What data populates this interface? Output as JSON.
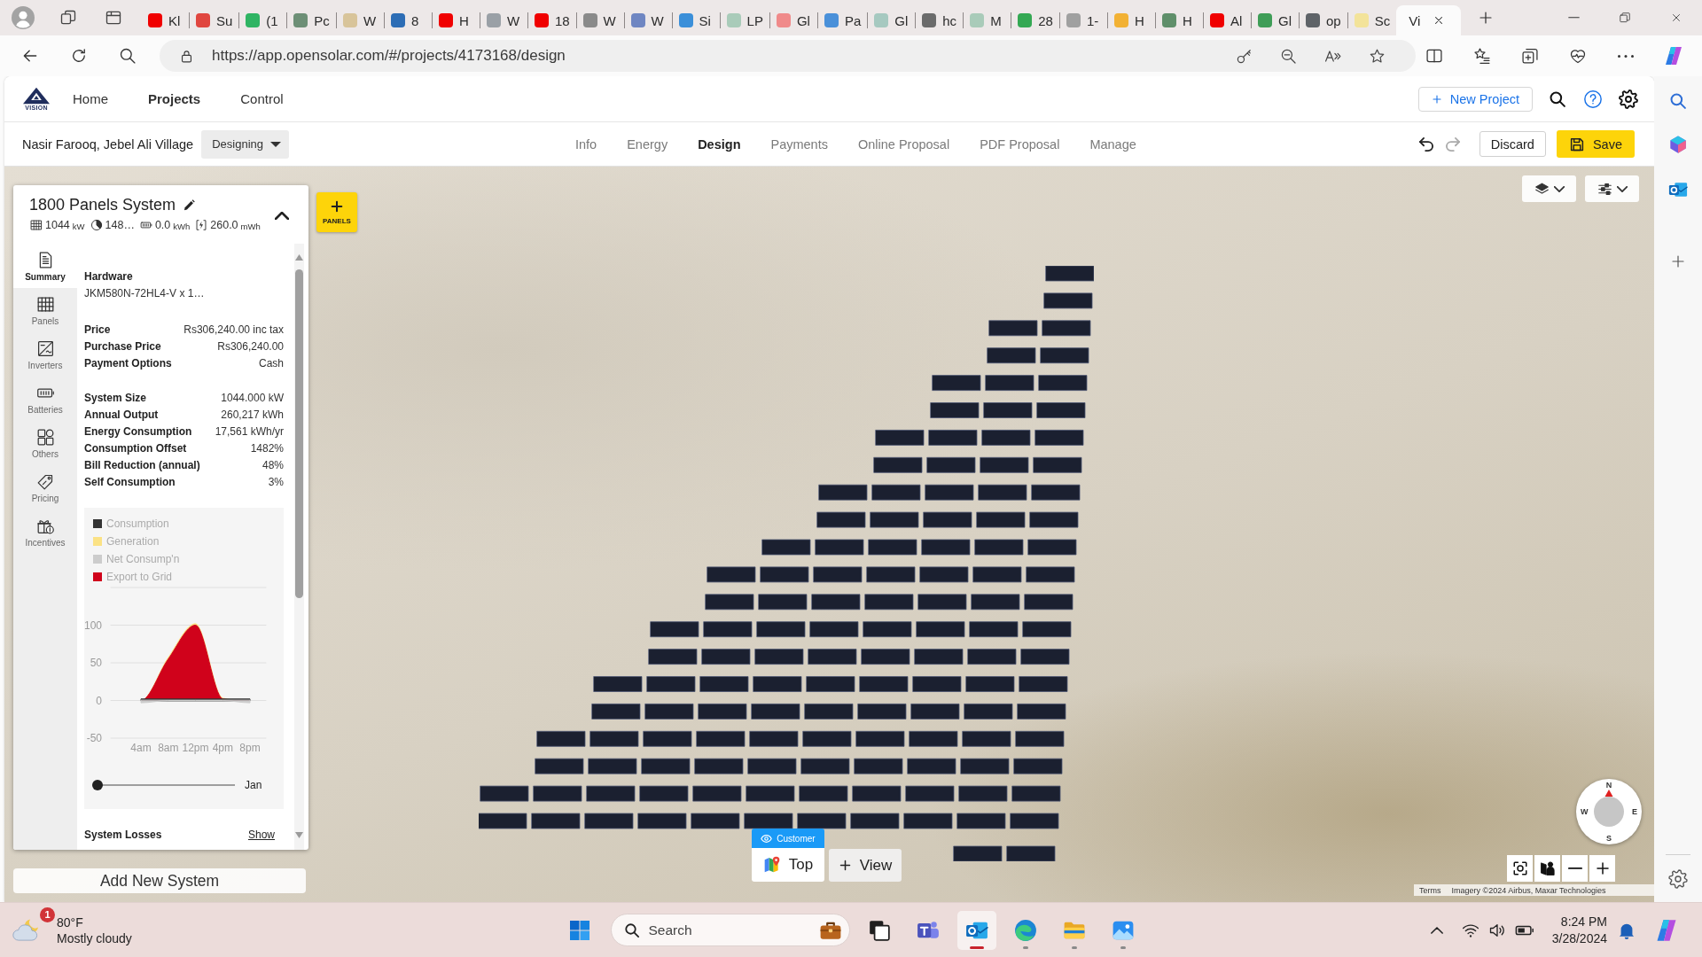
{
  "browser": {
    "tabs": [
      {
        "title": "Kl",
        "color": "#f00000",
        "selected": false
      },
      {
        "title": "Su",
        "color": "#e0463f",
        "selected": false
      },
      {
        "title": "(1",
        "color": "#2fb463",
        "selected": false
      },
      {
        "title": "Pc",
        "color": "#6d8f76",
        "selected": false
      },
      {
        "title": "W",
        "color": "#d8c49a",
        "selected": false
      },
      {
        "title": "8",
        "color": "#2d6db5",
        "selected": false
      },
      {
        "title": "H",
        "color": "#f00000",
        "selected": false
      },
      {
        "title": "W",
        "color": "#9aa0a6",
        "selected": false
      },
      {
        "title": "18",
        "color": "#f00000",
        "selected": false
      },
      {
        "title": "W",
        "color": "#8a8a8a",
        "selected": false
      },
      {
        "title": "W",
        "color": "#6f86c2",
        "selected": false
      },
      {
        "title": "Si",
        "color": "#3b8fd9",
        "selected": false
      },
      {
        "title": "LP",
        "color": "#a9cbb9",
        "selected": false
      },
      {
        "title": "Gl",
        "color": "#f08a8a",
        "selected": false
      },
      {
        "title": "Pa",
        "color": "#4a90d9",
        "selected": false
      },
      {
        "title": "Gl",
        "color": "#a6c9c0",
        "selected": false
      },
      {
        "title": "hc",
        "color": "#6b6b6b",
        "selected": false
      },
      {
        "title": "M",
        "color": "#a9cbb9",
        "selected": false
      },
      {
        "title": "28",
        "color": "#34a853",
        "selected": false
      },
      {
        "title": "1-",
        "color": "#a0a0a0",
        "selected": false
      },
      {
        "title": "H",
        "color": "#f2b134",
        "selected": false
      },
      {
        "title": "H",
        "color": "#5f8f6a",
        "selected": false
      },
      {
        "title": "Al",
        "color": "#f00000",
        "selected": false
      },
      {
        "title": "Gl",
        "color": "#3f9d57",
        "selected": false
      },
      {
        "title": "op",
        "color": "#5f6368",
        "selected": false
      },
      {
        "title": "Sc",
        "color": "#f3e39a",
        "selected": false
      },
      {
        "title": "Vi",
        "selected": true
      }
    ],
    "url": "https://app.opensolar.com/#/projects/4173168/design"
  },
  "app": {
    "logo_text": "VISION",
    "nav": [
      {
        "label": "Home",
        "selected": false
      },
      {
        "label": "Projects",
        "selected": true
      },
      {
        "label": "Control",
        "selected": false
      }
    ],
    "new_project_button": "New Project",
    "project_name": "Nasir Farooq, Jebel Ali Village",
    "stage": "Designing",
    "tabs": [
      {
        "label": "Info",
        "selected": false
      },
      {
        "label": "Energy",
        "selected": false
      },
      {
        "label": "Design",
        "selected": true
      },
      {
        "label": "Payments",
        "selected": false
      },
      {
        "label": "Online Proposal",
        "selected": false
      },
      {
        "label": "PDF Proposal",
        "selected": false
      },
      {
        "label": "Manage",
        "selected": false
      }
    ],
    "discard_button": "Discard",
    "save_button": "Save"
  },
  "system": {
    "title": "1800 Panels System",
    "stats": [
      {
        "kind": "size",
        "value": "1044",
        "unit": "kW"
      },
      {
        "kind": "output",
        "value": "148…"
      },
      {
        "kind": "battery",
        "value": "0.0",
        "unit": "kWh"
      },
      {
        "kind": "energy",
        "value": "260.0",
        "unit": "mWh"
      }
    ],
    "side_nav": [
      {
        "kind": "summary",
        "label": "Summary",
        "selected": true
      },
      {
        "kind": "panels",
        "label": "Panels",
        "selected": false
      },
      {
        "kind": "inverters",
        "label": "Inverters",
        "selected": false
      },
      {
        "kind": "batteries",
        "label": "Batteries",
        "selected": false
      },
      {
        "kind": "others",
        "label": "Others",
        "selected": false
      },
      {
        "kind": "pricing",
        "label": "Pricing",
        "selected": false
      },
      {
        "kind": "incentives",
        "label": "Incentives",
        "selected": false
      }
    ],
    "hardware": {
      "label": "Hardware",
      "value": "JKM580N-72HL4-V x 1…"
    },
    "pricing": [
      {
        "label": "Price",
        "value": "Rs306,240.00 inc tax"
      },
      {
        "label": "Purchase Price",
        "value": "Rs306,240.00"
      },
      {
        "label": "Payment Options",
        "value": "Cash"
      }
    ],
    "metrics": [
      {
        "label": "System Size",
        "value": "1044.000 kW"
      },
      {
        "label": "Annual Output",
        "value": "260,217 kWh"
      },
      {
        "label": "Energy Consumption",
        "value": "17,561 kWh/yr"
      },
      {
        "label": "Consumption Offset",
        "value": "1482%"
      },
      {
        "label": "Bill Reduction (annual)",
        "value": "48%"
      },
      {
        "label": "Self Consumption",
        "value": "3%"
      }
    ],
    "chart": {
      "chart_data": {
        "type": "area",
        "legend": "top",
        "grid": true,
        "categories": [
          "4am",
          "8am",
          "12pm",
          "4pm",
          "8pm"
        ],
        "ylim": [
          -50,
          150
        ],
        "yticks": [
          -50,
          0,
          50,
          100
        ],
        "series": [
          {
            "name": "Consumption",
            "color": "#333333",
            "values": [
              2,
              2,
              2,
              2,
              2
            ]
          },
          {
            "name": "Generation",
            "color": "#fbe285",
            "values": [
              0,
              57,
              102,
              3,
              0
            ]
          },
          {
            "name": "Net Consump'n",
            "color": "#cccccc",
            "values": [
              -3,
              0,
              0,
              0,
              -3
            ]
          },
          {
            "name": "Export to Grid",
            "color": "#d0021b",
            "values": [
              0,
              55,
              100,
              2,
              0
            ]
          }
        ]
      }
    },
    "month_slider": {
      "level": 0,
      "label": "Jan"
    },
    "losses": {
      "label": "System Losses",
      "link": "Show"
    },
    "add_system_button": "Add New System"
  },
  "map": {
    "panels_button": "PANELS",
    "views": [
      {
        "label": "Top",
        "badge": "Customer",
        "selected": true
      }
    ],
    "add_view_button": "View",
    "compass": [
      {
        "label": "N",
        "kind": "north"
      },
      {
        "label": "E",
        "kind": "east"
      },
      {
        "label": "S",
        "kind": "south"
      },
      {
        "label": "W",
        "kind": "west"
      }
    ],
    "attribution": {
      "terms": "Terms",
      "imagery": "Imagery ©2024 Airbus, Maxar Technologies"
    }
  },
  "taskbar": {
    "weather": {
      "badge": "1",
      "temperature": "80°F",
      "condition": "Mostly cloudy"
    },
    "search": {
      "placeholder": "Search"
    },
    "apps": [
      {
        "kind": "task-view",
        "running": false,
        "selected": false
      },
      {
        "kind": "chat",
        "running": false,
        "selected": false
      },
      {
        "kind": "mail",
        "running": true,
        "selected": true
      },
      {
        "kind": "browser",
        "running": true,
        "selected": false
      },
      {
        "kind": "folder",
        "running": true,
        "selected": false
      },
      {
        "kind": "photos",
        "running": true,
        "selected": false
      }
    ],
    "time": "8:24 PM",
    "date": "3/28/2024"
  }
}
